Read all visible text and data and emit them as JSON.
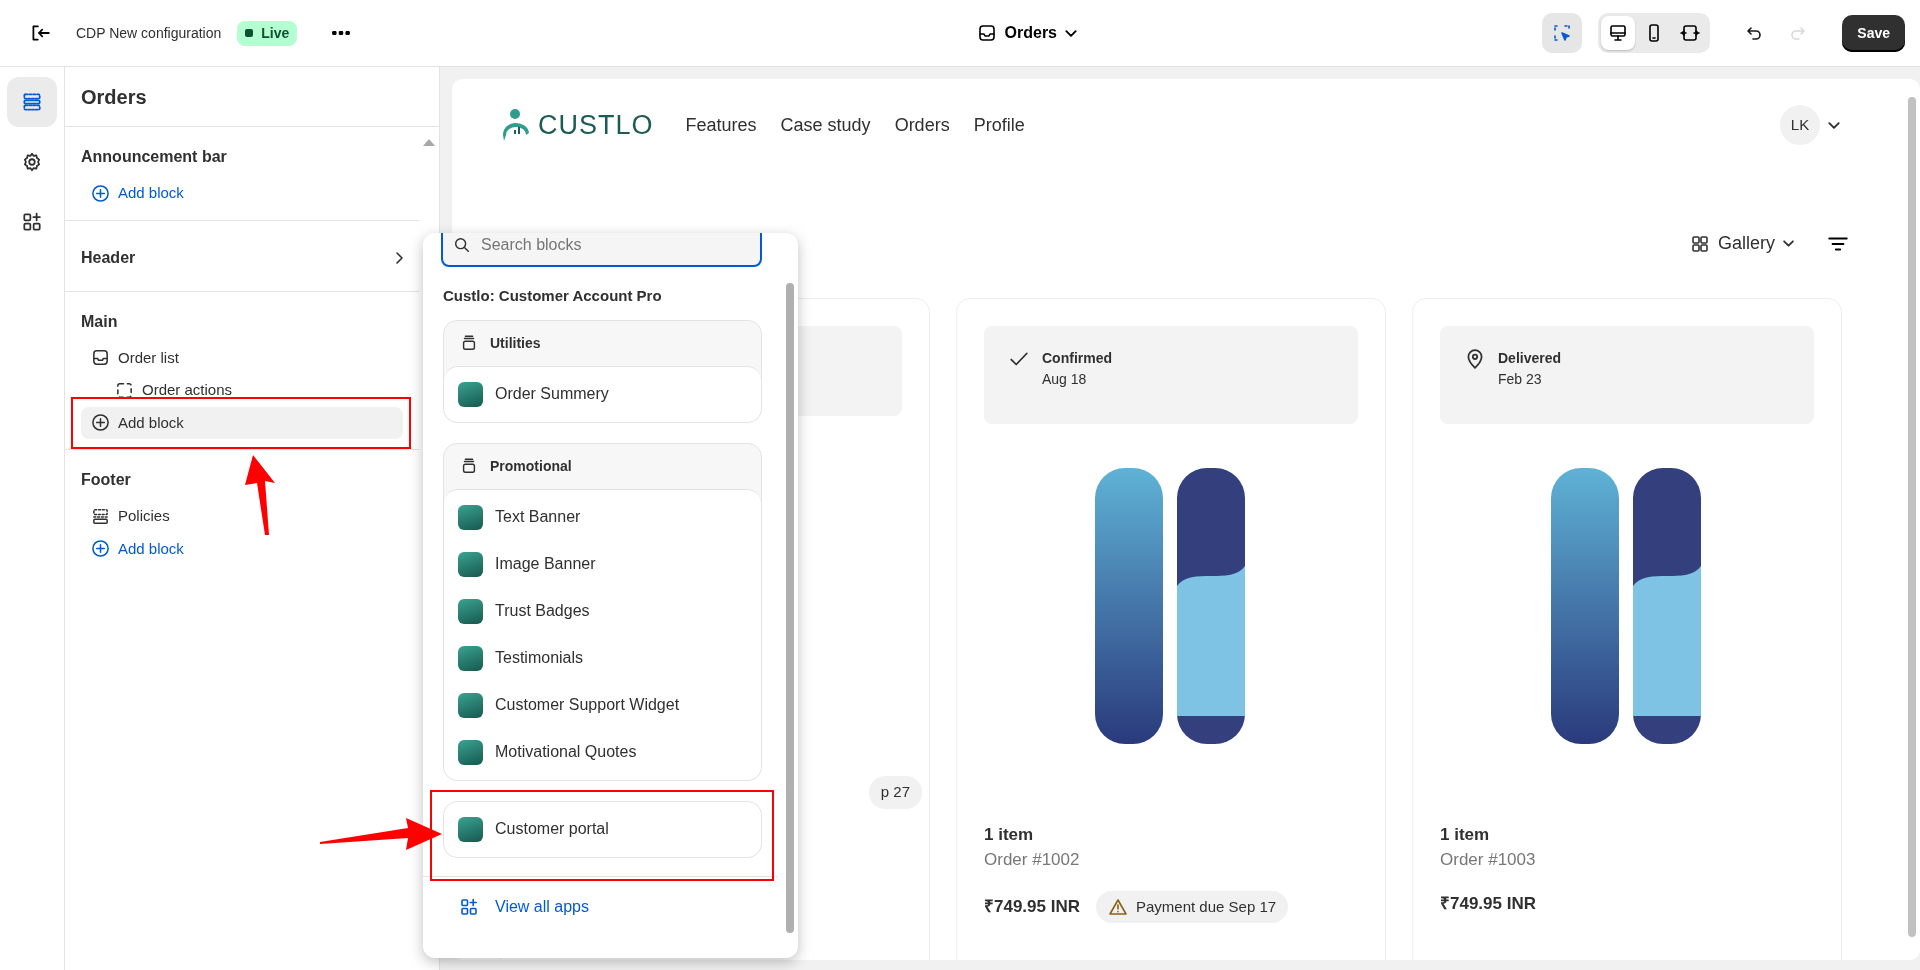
{
  "topbar": {
    "title": "CDP New configuration",
    "status_badge": "Live",
    "template": "Orders",
    "save": "Save",
    "tools": [
      {
        "kind": "inspect",
        "selected": true
      },
      {
        "kind": "desktop",
        "selected": true
      },
      {
        "kind": "mobile",
        "selected": false
      },
      {
        "kind": "fullwidth",
        "selected": false
      }
    ],
    "history": [
      {
        "kind": "undo",
        "disabled": false
      },
      {
        "kind": "redo",
        "disabled": true
      }
    ]
  },
  "rail": [
    {
      "kind": "sections",
      "selected": true
    },
    {
      "kind": "settings",
      "selected": false
    },
    {
      "kind": "apps",
      "selected": false
    }
  ],
  "sidebar": {
    "title": "Orders",
    "groups": [
      {
        "title": "Announcement bar",
        "collapsible": false,
        "items": [
          {
            "kind": "add",
            "label": "Add block",
            "hovered": false
          }
        ]
      },
      {
        "title": "Header",
        "collapsible": true
      },
      {
        "title": "Main",
        "collapsible": false,
        "items": [
          {
            "kind": "list",
            "label": "Order list",
            "hovered": false,
            "children": [
              {
                "kind": "block",
                "label": "Order actions",
                "hovered": false
              }
            ]
          },
          {
            "kind": "add",
            "label": "Add block",
            "hovered": true
          }
        ]
      },
      {
        "title": "Footer",
        "collapsible": false,
        "items": [
          {
            "kind": "policy",
            "label": "Policies",
            "hovered": false
          },
          {
            "kind": "add",
            "label": "Add block",
            "hovered": false
          }
        ]
      }
    ]
  },
  "block_picker": {
    "search": {
      "placeholder": "Search blocks"
    },
    "app_name": "Custlo: Customer Account Pro",
    "groups": [
      {
        "title": "Utilities",
        "items": [
          "Order Summery"
        ]
      },
      {
        "title": "Promotional",
        "items": [
          "Text Banner",
          "Image Banner",
          "Trust Badges",
          "Testimonials",
          "Customer Support Widget",
          "Motivational Quotes"
        ]
      },
      {
        "items": [
          "Customer portal"
        ]
      }
    ],
    "footer_link": "View all apps"
  },
  "preview": {
    "brand": "CUSTLO",
    "nav": [
      "Features",
      "Case study",
      "Orders",
      "Profile"
    ],
    "avatar": "LK",
    "view": "Gallery",
    "orders": [
      {
        "badge": {
          "text": "p 27"
        }
      },
      {
        "kind": "confirmed",
        "status": "Confirmed",
        "date": "Aug 18",
        "items": "1 item",
        "number": "Order #1002",
        "price": "₹749.95 INR",
        "badge": {
          "kind": "warning",
          "text": "Payment due Sep 17"
        }
      },
      {
        "kind": "delivered",
        "status": "Delivered",
        "date": "Feb 23",
        "items": "1 item",
        "number": "Order #1003",
        "price": "₹749.95 INR"
      }
    ]
  }
}
